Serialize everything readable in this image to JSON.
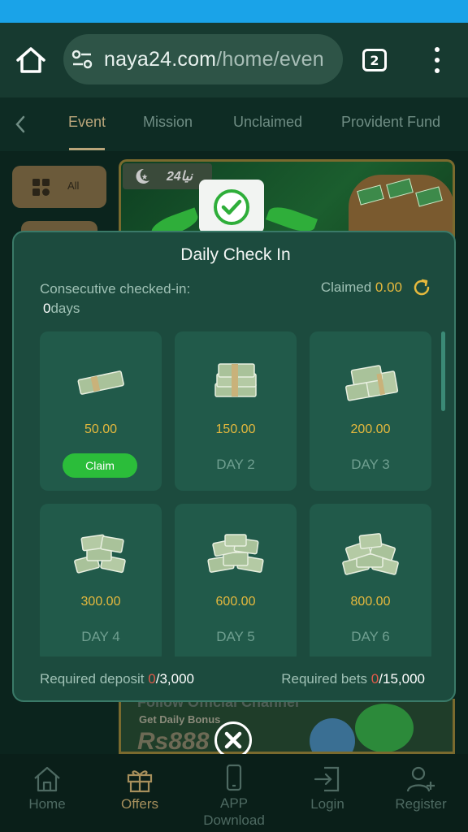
{
  "browser": {
    "url_main": "naya24.com",
    "url_path": "/home/even",
    "tab_count": "2"
  },
  "tabs": [
    {
      "label": "Event",
      "active": true
    },
    {
      "label": "Mission",
      "active": false
    },
    {
      "label": "Unclaimed",
      "active": false
    },
    {
      "label": "Provident Fund",
      "active": false
    }
  ],
  "sidebar": {
    "all_label": "All"
  },
  "banner": {
    "logo_text": "24نیا"
  },
  "modal": {
    "title": "Daily Check In",
    "consecutive_label": "Consecutive checked-in:",
    "consecutive_days": "0",
    "days_unit": "days",
    "claimed_label": "Claimed",
    "claimed_amount": "0.00",
    "cards": [
      {
        "amount": "50.00",
        "claim_label": "Claim",
        "day": ""
      },
      {
        "amount": "150.00",
        "day": "DAY 2"
      },
      {
        "amount": "200.00",
        "day": "DAY 3"
      },
      {
        "amount": "300.00",
        "day": "DAY 4"
      },
      {
        "amount": "600.00",
        "day": "DAY 5"
      },
      {
        "amount": "800.00",
        "day": "DAY 6"
      }
    ],
    "required_deposit_label": "Required deposit",
    "required_deposit_current": "0",
    "required_deposit_total": "/3,000",
    "required_bets_label": "Required bets",
    "required_bets_current": "0",
    "required_bets_total": "/15,000"
  },
  "bottom_banner": {
    "line1": "Follow Official Channel",
    "line2": "Get Daily Bonus",
    "line3": "Rs888"
  },
  "bottom_nav": [
    {
      "label": "Home",
      "icon": "home-icon"
    },
    {
      "label": "Offers",
      "icon": "gift-icon",
      "active": true
    },
    {
      "label": "APP Download",
      "icon": "phone-icon"
    },
    {
      "label": "Login",
      "icon": "login-icon"
    },
    {
      "label": "Register",
      "icon": "add-user-icon"
    }
  ],
  "colors": {
    "accent_gold": "#e6b93d",
    "claim_green": "#2bbd3a",
    "modal_bg": "#1c4b3e",
    "deposit_red": "#e05a4a"
  }
}
